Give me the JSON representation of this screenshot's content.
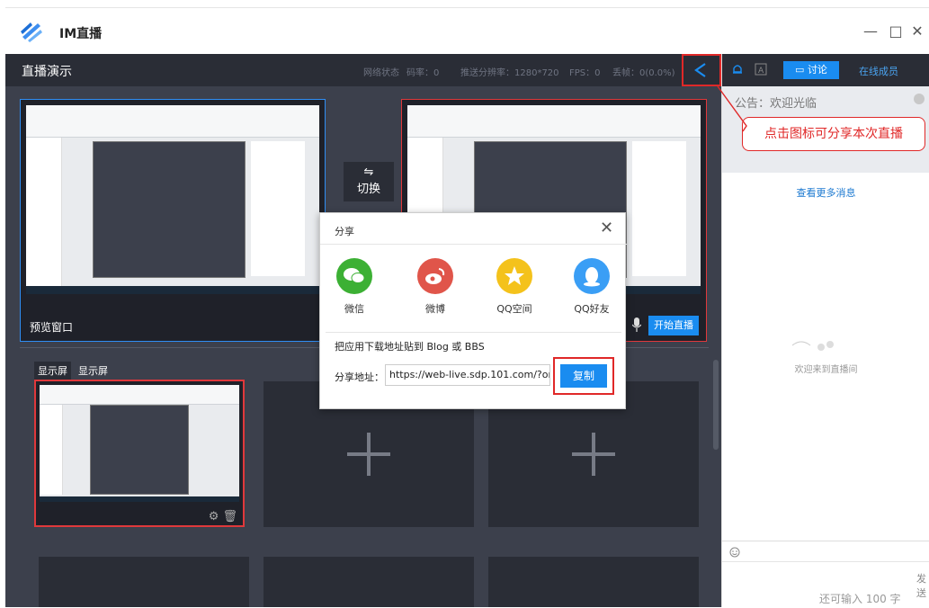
{
  "app": {
    "title": "IM直播"
  },
  "window_controls": {
    "minimize": "—",
    "maximize": "□",
    "close": "✕"
  },
  "header": {
    "title": "直播演示",
    "stats": {
      "network": "网络状态",
      "bitrate": "码率：0",
      "resolution": "推送分辨率：1280*720",
      "fps": "FPS：0",
      "loss": "丢帧：0(0.0%)"
    }
  },
  "preview": {
    "label": "预览窗口",
    "switch_label": "切换",
    "start_label": "开始直播"
  },
  "monitors": {
    "tabs": [
      "显示屏",
      "显示屏"
    ]
  },
  "right_panel": {
    "tab_discuss": "讨论",
    "tab_members": "在线成员",
    "notice": "公告：欢迎光临",
    "callout": "点击图标可分享本次直播",
    "more_messages": "查看更多消息",
    "welcome": "欢迎来到直播间",
    "remaining": "还可输入 100 字",
    "send": "发送"
  },
  "share_dialog": {
    "title": "分享",
    "items": [
      {
        "label": "微信",
        "icon": "wechat-icon",
        "color": "#3cb034"
      },
      {
        "label": "微博",
        "icon": "weibo-icon",
        "color": "#e0554a"
      },
      {
        "label": "QQ空间",
        "icon": "qzone-icon",
        "color": "#f4c21b"
      },
      {
        "label": "QQ好友",
        "icon": "qq-icon",
        "color": "#3a9ef5"
      }
    ],
    "tip": "把应用下载地址贴到 Blog 或 BBS",
    "address_label": "分享地址：",
    "address_value": "https://web-live.sdp.101.com/?or...",
    "copy_label": "复制"
  },
  "colors": {
    "accent": "#1a8cf0",
    "highlight": "#e02828",
    "dark_bg": "#3c404c"
  }
}
